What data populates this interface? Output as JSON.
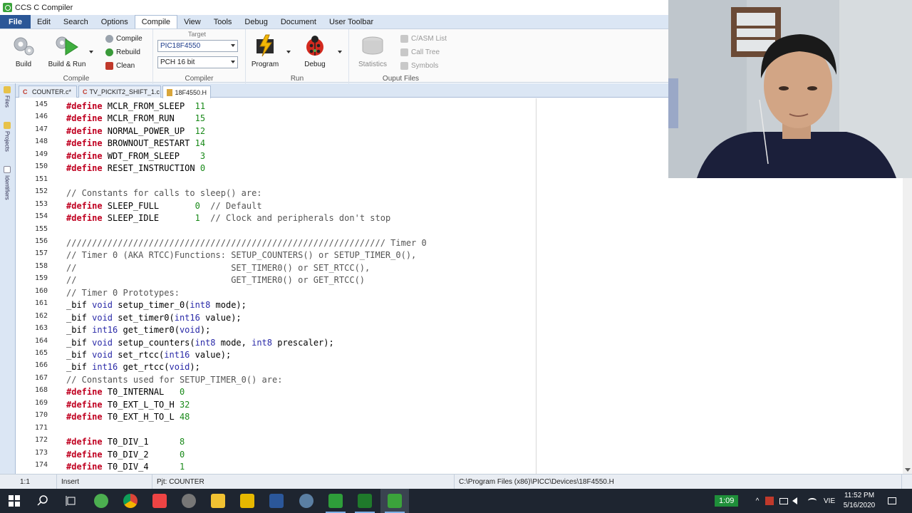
{
  "window": {
    "title": "CCS C Compiler"
  },
  "menu": [
    {
      "label": "File"
    },
    {
      "label": "Edit"
    },
    {
      "label": "Search"
    },
    {
      "label": "Options"
    },
    {
      "label": "Compile"
    },
    {
      "label": "View"
    },
    {
      "label": "Tools"
    },
    {
      "label": "Debug"
    },
    {
      "label": "Document"
    },
    {
      "label": "User Toolbar"
    }
  ],
  "ribbon": {
    "compile_group": {
      "label": "Compile",
      "build": "Build",
      "build_run": "Build & Run",
      "compile": "Compile",
      "rebuild": "Rebuild",
      "clean": "Clean"
    },
    "compiler_group": {
      "label": "Compiler",
      "target_label": "Target",
      "target_value": "PIC18F4550",
      "compiler_value": "PCH 16 bit"
    },
    "run_group": {
      "label": "Run",
      "program": "Program",
      "debug": "Debug"
    },
    "output_group": {
      "label": "Ouput Files",
      "statistics": "Statistics",
      "casm_list": "C/ASM List",
      "call_tree": "Call Tree",
      "symbols": "Symbols"
    }
  },
  "tabs": [
    {
      "label": "COUNTER.c*"
    },
    {
      "label": "TV_PICKIT2_SHIFT_1.c"
    },
    {
      "label": "18F4550.H"
    }
  ],
  "side_tabs": [
    "Files",
    "Projects",
    "Identifiers"
  ],
  "editor": {
    "line_numbers": [
      "145",
      "146",
      "147",
      "148",
      "149",
      "150",
      "151",
      "152",
      "153",
      "154",
      "155",
      "156",
      "157",
      "158",
      "159",
      "160",
      "161",
      "162",
      "163",
      "164",
      "165",
      "166",
      "167",
      "168",
      "169",
      "170",
      "171",
      "172",
      "173",
      "174"
    ],
    "lines": [
      [
        [
          "kw",
          "#define"
        ],
        [
          "id",
          " MCLR_FROM_SLEEP  "
        ],
        [
          "num",
          "11"
        ]
      ],
      [
        [
          "kw",
          "#define"
        ],
        [
          "id",
          " MCLR_FROM_RUN    "
        ],
        [
          "num",
          "15"
        ]
      ],
      [
        [
          "kw",
          "#define"
        ],
        [
          "id",
          " NORMAL_POWER_UP  "
        ],
        [
          "num",
          "12"
        ]
      ],
      [
        [
          "kw",
          "#define"
        ],
        [
          "id",
          " BROWNOUT_RESTART "
        ],
        [
          "num",
          "14"
        ]
      ],
      [
        [
          "kw",
          "#define"
        ],
        [
          "id",
          " WDT_FROM_SLEEP    "
        ],
        [
          "num",
          "3"
        ]
      ],
      [
        [
          "kw",
          "#define"
        ],
        [
          "id",
          " RESET_INSTRUCTION "
        ],
        [
          "num",
          "0"
        ]
      ],
      [],
      [
        [
          "cm",
          "// Constants for calls to sleep() are:"
        ]
      ],
      [
        [
          "kw",
          "#define"
        ],
        [
          "id",
          " SLEEP_FULL       "
        ],
        [
          "num",
          "0"
        ],
        [
          "cm",
          "  // Default"
        ]
      ],
      [
        [
          "kw",
          "#define"
        ],
        [
          "id",
          " SLEEP_IDLE       "
        ],
        [
          "num",
          "1"
        ],
        [
          "cm",
          "  // Clock and peripherals don't stop"
        ]
      ],
      [],
      [
        [
          "cm",
          "////////////////////////////////////////////////////////////// Timer 0"
        ]
      ],
      [
        [
          "cm",
          "// Timer 0 (AKA RTCC)Functions: SETUP_COUNTERS() or SETUP_TIMER_0(),"
        ]
      ],
      [
        [
          "cm",
          "//                              SET_TIMER0() or SET_RTCC(),"
        ]
      ],
      [
        [
          "cm",
          "//                              GET_TIMER0() or GET_RTCC()"
        ]
      ],
      [
        [
          "cm",
          "// Timer 0 Prototypes:"
        ]
      ],
      [
        [
          "id",
          "_bif "
        ],
        [
          "ty",
          "void"
        ],
        [
          "id",
          " setup_timer_0("
        ],
        [
          "ty",
          "int8"
        ],
        [
          "id",
          " mode);"
        ]
      ],
      [
        [
          "id",
          "_bif "
        ],
        [
          "ty",
          "void"
        ],
        [
          "id",
          " set_timer0("
        ],
        [
          "ty",
          "int16"
        ],
        [
          "id",
          " value);"
        ]
      ],
      [
        [
          "id",
          "_bif "
        ],
        [
          "ty",
          "int16"
        ],
        [
          "id",
          " get_timer0("
        ],
        [
          "ty",
          "void"
        ],
        [
          "id",
          ");"
        ]
      ],
      [
        [
          "id",
          "_bif "
        ],
        [
          "ty",
          "void"
        ],
        [
          "id",
          " setup_counters("
        ],
        [
          "ty",
          "int8"
        ],
        [
          "id",
          " mode, "
        ],
        [
          "ty",
          "int8"
        ],
        [
          "id",
          " prescaler);"
        ]
      ],
      [
        [
          "id",
          "_bif "
        ],
        [
          "ty",
          "void"
        ],
        [
          "id",
          " set_rtcc("
        ],
        [
          "ty",
          "int16"
        ],
        [
          "id",
          " value);"
        ]
      ],
      [
        [
          "id",
          "_bif "
        ],
        [
          "ty",
          "int16"
        ],
        [
          "id",
          " get_rtcc("
        ],
        [
          "ty",
          "void"
        ],
        [
          "id",
          ");"
        ]
      ],
      [
        [
          "cm",
          "// Constants used for SETUP_TIMER_0() are:"
        ]
      ],
      [
        [
          "kw",
          "#define"
        ],
        [
          "id",
          " T0_INTERNAL   "
        ],
        [
          "num",
          "0"
        ]
      ],
      [
        [
          "kw",
          "#define"
        ],
        [
          "id",
          " T0_EXT_L_TO_H "
        ],
        [
          "num",
          "32"
        ]
      ],
      [
        [
          "kw",
          "#define"
        ],
        [
          "id",
          " T0_EXT_H_TO_L "
        ],
        [
          "num",
          "48"
        ]
      ],
      [],
      [
        [
          "kw",
          "#define"
        ],
        [
          "id",
          " T0_DIV_1      "
        ],
        [
          "num",
          "8"
        ]
      ],
      [
        [
          "kw",
          "#define"
        ],
        [
          "id",
          " T0_DIV_2      "
        ],
        [
          "num",
          "0"
        ]
      ],
      [
        [
          "kw",
          "#define"
        ],
        [
          "id",
          " T0_DIV_4      "
        ],
        [
          "num",
          "1"
        ]
      ]
    ]
  },
  "status": {
    "position": "1:1",
    "mode": "Insert",
    "project": "Pjt: COUNTER",
    "path": "C:\\Program Files (x86)\\PICC\\Devices\\18F4550.H"
  },
  "taskbar": {
    "timer": "1:09",
    "lang": "VIE",
    "time": "11:52 PM",
    "date": "5/16/2020"
  },
  "colors": {
    "keyword": "#c00020",
    "type": "#2a2aa8",
    "number": "#1a8a1a",
    "comment": "#555555",
    "menubar": "#dbe6f4",
    "file_menu": "#2b5797",
    "taskbar": "#1e2530"
  }
}
